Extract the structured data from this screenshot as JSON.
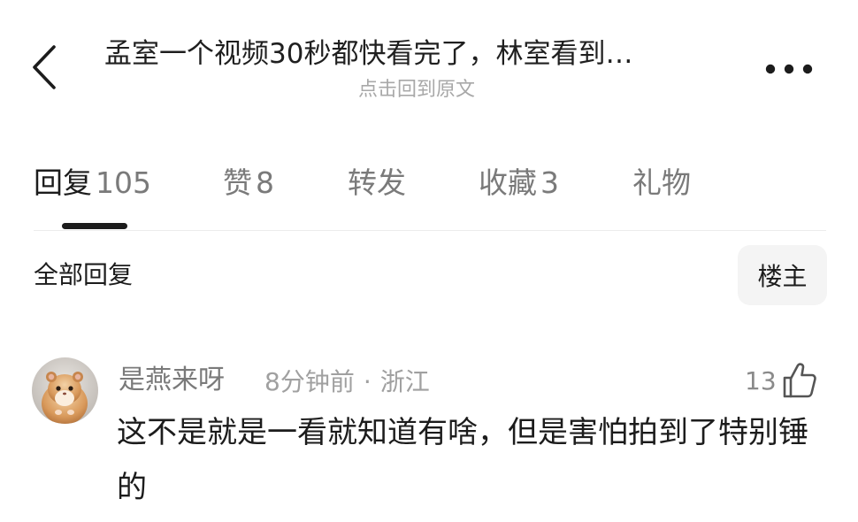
{
  "header": {
    "title": "孟室一个视频30秒都快看完了，林室看到…",
    "subtitle": "点击回到原文",
    "back_icon": "chevron-left-icon",
    "more_icon": "more-horizontal-icon"
  },
  "tabs": [
    {
      "name": "回复",
      "count": "105"
    },
    {
      "name": "赞",
      "count": "8"
    },
    {
      "name": "转发",
      "count": ""
    },
    {
      "name": "收藏",
      "count": "3"
    },
    {
      "name": "礼物",
      "count": ""
    }
  ],
  "filter": {
    "label": "全部回复",
    "owner_button": "楼主"
  },
  "comment": {
    "username": "是燕来呀",
    "time": "8分钟前",
    "separator": "·",
    "location": "浙江",
    "like_count": "13",
    "like_icon": "thumbs-up-icon",
    "avatar_icon": "hamster-avatar",
    "text": "这不是就是一看就知道有啥，但是害怕拍到了特别锤的"
  },
  "colors": {
    "primary_text": "#1c1c1c",
    "secondary_text": "#7a7a7a",
    "muted_text": "#a0a0a0",
    "button_bg": "#f4f4f4"
  }
}
